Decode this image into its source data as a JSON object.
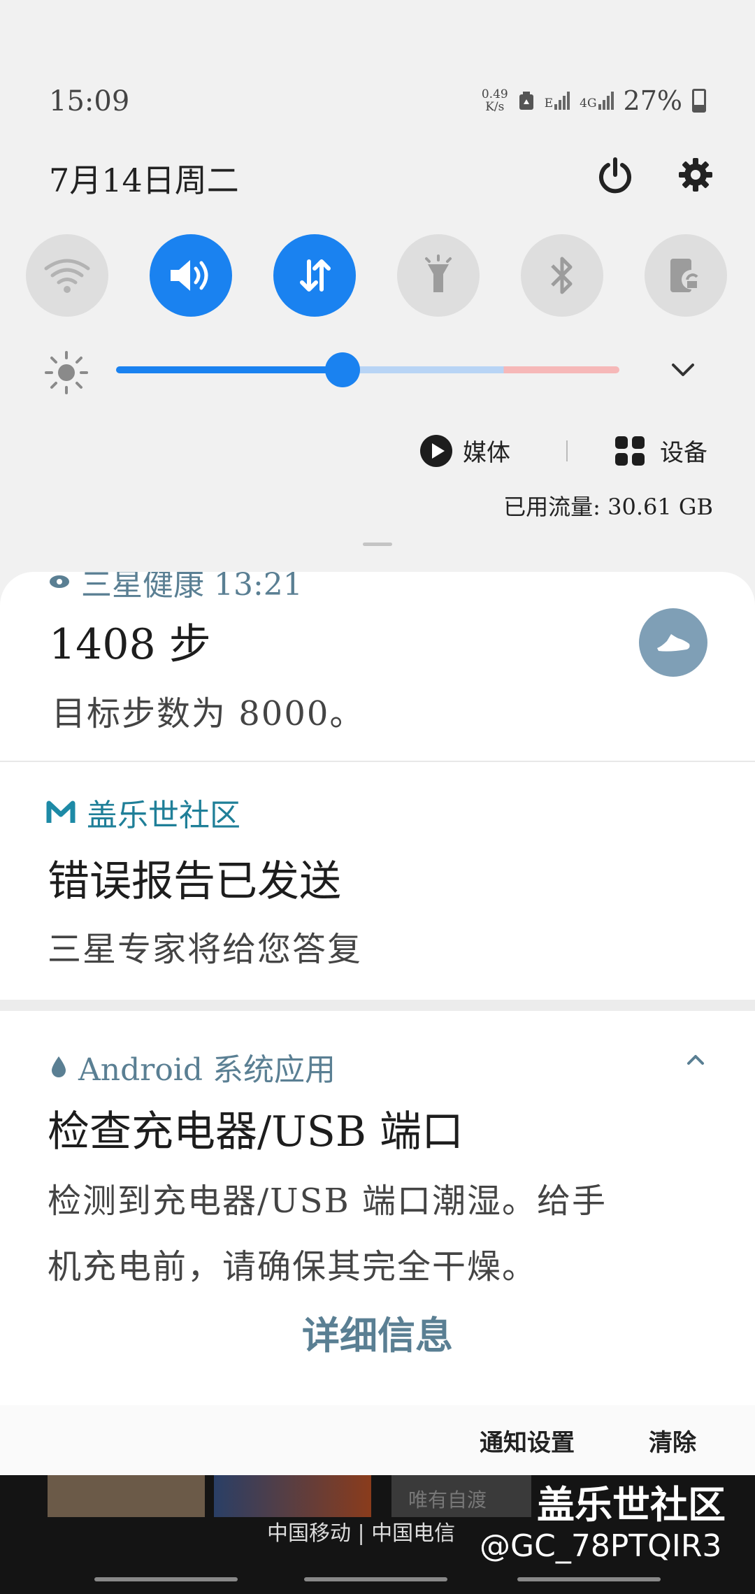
{
  "status_bar": {
    "time": "15:09",
    "speed_value": "0.49",
    "speed_unit": "K/s",
    "net1": "E",
    "net2": "4G",
    "battery": "27%"
  },
  "header": {
    "date": "7月14日周二"
  },
  "toggles": [
    {
      "name": "wifi",
      "on": false
    },
    {
      "name": "sound",
      "on": true
    },
    {
      "name": "mobile-data",
      "on": true
    },
    {
      "name": "flashlight",
      "on": false
    },
    {
      "name": "bluetooth",
      "on": false
    },
    {
      "name": "rotation-lock",
      "on": false
    }
  ],
  "brightness": {
    "level": 0.45
  },
  "media_row": {
    "media_label": "媒体",
    "devices_label": "设备"
  },
  "data_usage": "已用流量: 30.61 GB",
  "notifications": {
    "health": {
      "app_partial": "三星健康  13:21",
      "title": "1408 步",
      "body": "目标步数为 8000。"
    },
    "community": {
      "app": "盖乐世社区",
      "title": "错误报告已发送",
      "body": "三星专家将给您答复"
    },
    "android": {
      "app": "Android 系统应用",
      "title": "检查充电器/USB 端口",
      "body_line1": "检测到充电器/USB 端口潮湿。给手",
      "body_line2": "机充电前，请确保其完全干燥。",
      "action": "详细信息"
    }
  },
  "footer": {
    "settings_label": "通知设置",
    "clear_label": "清除"
  },
  "background": {
    "carrier": "中国移动 | 中国电信",
    "watermark_title": "盖乐世社区",
    "watermark_user": "@GC_78PTQIR3",
    "thumb_text": "唯有自渡"
  },
  "colors": {
    "accent": "#1a82f0",
    "app_name": "#5a7f93"
  }
}
